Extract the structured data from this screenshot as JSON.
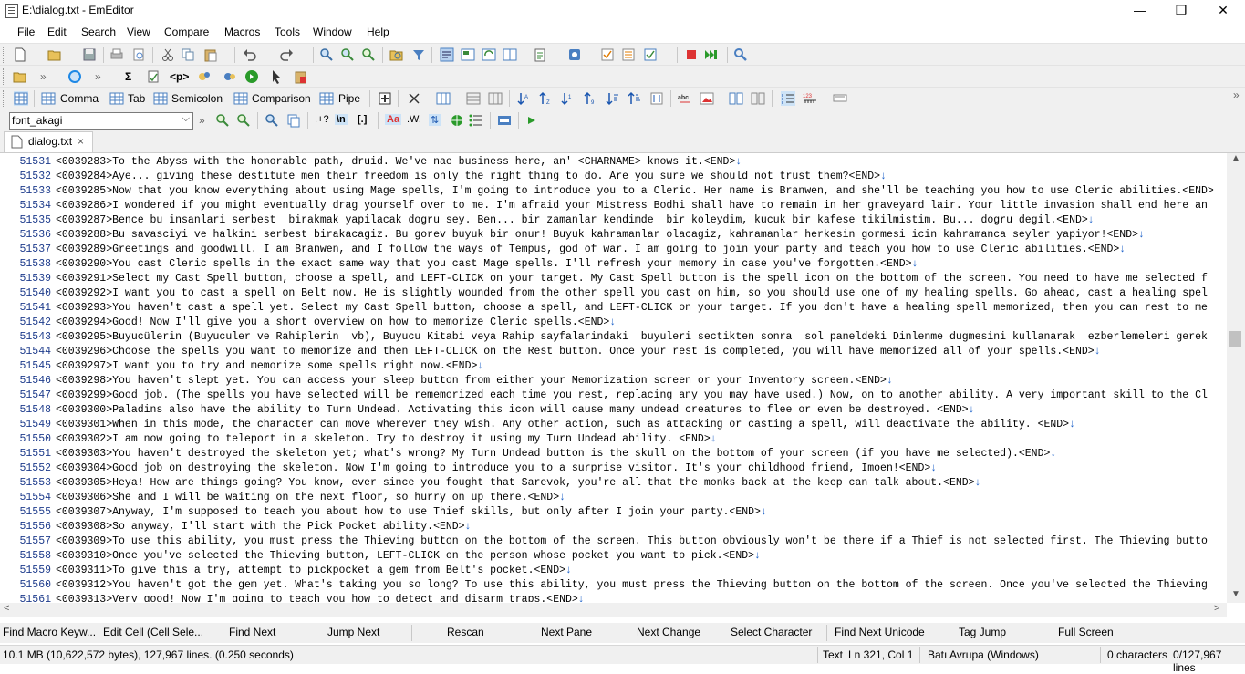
{
  "window": {
    "title": "E:\\dialog.txt - EmEditor",
    "minimize": "—",
    "restore": "❐",
    "close": "✕"
  },
  "menu": [
    "File",
    "Edit",
    "Search",
    "View",
    "Compare",
    "Macros",
    "Tools",
    "Window",
    "Help"
  ],
  "csv_toolbar": {
    "comma": "Comma",
    "tab": "Tab",
    "semicolon": "Semicolon",
    "comparison": "Comparison",
    "pipe": "Pipe"
  },
  "search_toolbar": {
    "search_value": "font_akagi"
  },
  "tab": {
    "label": "dialog.txt",
    "close": "×"
  },
  "editor": {
    "lines": [
      {
        "n": "51531",
        "t": "<0039283>To the Abyss with the honorable path, druid. We've nae business here, an' <CHARNAME> knows it.<END>",
        "eol": "↓"
      },
      {
        "n": "51532",
        "t": "<0039284>Aye... giving these destitute men their freedom is only the right thing to do. Are you sure we should not trust them?<END>",
        "eol": "↓"
      },
      {
        "n": "51533",
        "t": "<0039285>Now that you know everything about using Mage spells, I'm going to introduce you to a Cleric. Her name is Branwen, and she'll be teaching you how to use Cleric abilities.<END>",
        "eol": ""
      },
      {
        "n": "51534",
        "t": "<0039286>I wondered if you might eventually drag yourself over to me. I'm afraid your Mistress Bodhi shall have to remain in her graveyard lair. Your little invasion shall end here an",
        "eol": ""
      },
      {
        "n": "51535",
        "t": "<0039287>Bence bu insanlari serbest  birakmak yapilacak dogru sey. Ben... bir zamanlar kendimde  bir koleydim, kucuk bir kafese tikilmistim. Bu... dogru degil.<END>",
        "eol": "↓"
      },
      {
        "n": "51536",
        "t": "<0039288>Bu savasciyi ve halkini serbest birakacagiz. Bu gorev buyuk bir onur! Buyuk kahramanlar olacagiz, kahramanlar herkesin gormesi icin kahramanca seyler yapiyor!<END>",
        "eol": "↓"
      },
      {
        "n": "51537",
        "t": "<0039289>Greetings and goodwill. I am Branwen, and I follow the ways of Tempus, god of war. I am going to join your party and teach you how to use Cleric abilities.<END>",
        "eol": "↓"
      },
      {
        "n": "51538",
        "t": "<0039290>You cast Cleric spells in the exact same way that you cast Mage spells. I'll refresh your memory in case you've forgotten.<END>",
        "eol": "↓"
      },
      {
        "n": "51539",
        "t": "<0039291>Select my Cast Spell button, choose a spell, and LEFT-CLICK on your target. My Cast Spell button is the spell icon on the bottom of the screen. You need to have me selected f",
        "eol": ""
      },
      {
        "n": "51540",
        "t": "<0039292>I want you to cast a spell on Belt now. He is slightly wounded from the other spell you cast on him, so you should use one of my healing spells. Go ahead, cast a healing spel",
        "eol": ""
      },
      {
        "n": "51541",
        "t": "<0039293>You haven't cast a spell yet. Select my Cast Spell button, choose a spell, and LEFT-CLICK on your target. If you don't have a healing spell memorized, then you can rest to me",
        "eol": ""
      },
      {
        "n": "51542",
        "t": "<0039294>Good! Now I'll give you a short overview on how to memorize Cleric spells.<END>",
        "eol": "↓"
      },
      {
        "n": "51543",
        "t": "<0039295>Buyucülerin (Buyuculer ve Rahiplerin  vb), Buyucu Kitabi veya Rahip sayfalarindaki  buyuleri sectikten sonra  sol paneldeki Dinlenme dugmesini kullanarak  ezberlemeleri gerek",
        "eol": ""
      },
      {
        "n": "51544",
        "t": "<0039296>Choose the spells you want to memorize and then LEFT-CLICK on the Rest button. Once your rest is completed, you will have memorized all of your spells.<END>",
        "eol": "↓"
      },
      {
        "n": "51545",
        "t": "<0039297>I want you to try and memorize some spells right now.<END>",
        "eol": "↓"
      },
      {
        "n": "51546",
        "t": "<0039298>You haven't slept yet. You can access your sleep button from either your Memorization screen or your Inventory screen.<END>",
        "eol": "↓"
      },
      {
        "n": "51547",
        "t": "<0039299>Good job. (The spells you have selected will be rememorized each time you rest, replacing any you may have used.) Now, on to another ability. A very important skill to the Cl",
        "eol": ""
      },
      {
        "n": "51548",
        "t": "<0039300>Paladins also have the ability to Turn Undead. Activating this icon will cause many undead creatures to flee or even be destroyed. <END>",
        "eol": "↓"
      },
      {
        "n": "51549",
        "t": "<0039301>When in this mode, the character can move wherever they wish. Any other action, such as attacking or casting a spell, will deactivate the ability. <END>",
        "eol": "↓"
      },
      {
        "n": "51550",
        "t": "<0039302>I am now going to teleport in a skeleton. Try to destroy it using my Turn Undead ability. <END>",
        "eol": "↓"
      },
      {
        "n": "51551",
        "t": "<0039303>You haven't destroyed the skeleton yet; what's wrong? My Turn Undead button is the skull on the bottom of your screen (if you have me selected).<END>",
        "eol": "↓"
      },
      {
        "n": "51552",
        "t": "<0039304>Good job on destroying the skeleton. Now I'm going to introduce you to a surprise visitor. It's your childhood friend, Imoen!<END>",
        "eol": "↓"
      },
      {
        "n": "51553",
        "t": "<0039305>Heya! How are things going? You know, ever since you fought that Sarevok, you're all that the monks back at the keep can talk about.<END>",
        "eol": "↓"
      },
      {
        "n": "51554",
        "t": "<0039306>She and I will be waiting on the next floor, so hurry on up there.<END>",
        "eol": "↓"
      },
      {
        "n": "51555",
        "t": "<0039307>Anyway, I'm supposed to teach you about how to use Thief skills, but only after I join your party.<END>",
        "eol": "↓"
      },
      {
        "n": "51556",
        "t": "<0039308>So anyway, I'll start with the Pick Pocket ability.<END>",
        "eol": "↓"
      },
      {
        "n": "51557",
        "t": "<0039309>To use this ability, you must press the Thieving button on the bottom of the screen. This button obviously won't be there if a Thief is not selected first. The Thieving butto",
        "eol": ""
      },
      {
        "n": "51558",
        "t": "<0039310>Once you've selected the Thieving button, LEFT-CLICK on the person whose pocket you want to pick.<END>",
        "eol": "↓"
      },
      {
        "n": "51559",
        "t": "<0039311>To give this a try, attempt to pickpocket a gem from Belt's pocket.<END>",
        "eol": "↓"
      },
      {
        "n": "51560",
        "t": "<0039312>You haven't got the gem yet. What's taking you so long? To use this ability, you must press the Thieving button on the bottom of the screen. Once you've selected the Thieving",
        "eol": ""
      },
      {
        "n": "51561",
        "t": "<0039313>Very good! Now I'm going to teach you how to detect and disarm traps.<END>",
        "eol": "↓"
      }
    ]
  },
  "function_bar": [
    "Find Macro Keyw...",
    "Edit Cell (Cell Sele...",
    "Find Next",
    "Jump Next",
    "Rescan",
    "Next Pane",
    "Next Change",
    "Select Character",
    "Find Next Unicode",
    "Tag Jump",
    "Full Screen"
  ],
  "status": {
    "file_info": "10.1 MB (10,622,572 bytes), 127,967 lines. (0.250 seconds)",
    "mode": "Text",
    "position": "Ln 321, Col 1",
    "encoding": "Batı Avrupa (Windows)",
    "selection": "0 characters",
    "lines": "0/127,967 lines"
  }
}
